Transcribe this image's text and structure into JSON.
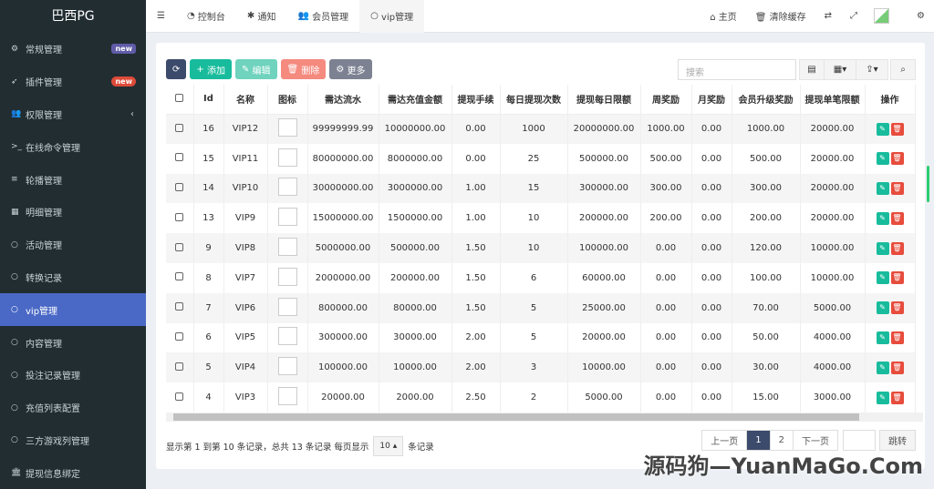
{
  "app": {
    "title": "巴西PG"
  },
  "sidebar": {
    "items": [
      {
        "label": "常规管理",
        "icon": "cogs-icon",
        "badge": "new",
        "badge_color": "#605ca8"
      },
      {
        "label": "插件管理",
        "icon": "rocket-icon",
        "badge": "new",
        "badge_color": "#dd4b39"
      },
      {
        "label": "权限管理",
        "icon": "users-icon",
        "chevron": "‹"
      },
      {
        "label": "在线命令管理",
        "icon": "terminal-icon"
      },
      {
        "label": "轮播管理",
        "icon": "list-icon"
      },
      {
        "label": "明细管理",
        "icon": "calendar-icon"
      },
      {
        "label": "活动管理",
        "icon": "circle-icon"
      },
      {
        "label": "转换记录",
        "icon": "circle-icon"
      },
      {
        "label": "vip管理",
        "icon": "circle-icon",
        "active": true
      },
      {
        "label": "内容管理",
        "icon": "circle-icon"
      },
      {
        "label": "投注记录管理",
        "icon": "circle-icon"
      },
      {
        "label": "充值列表配置",
        "icon": "circle-icon"
      },
      {
        "label": "三方游戏列管理",
        "icon": "circle-icon"
      },
      {
        "label": "提现信息绑定",
        "icon": "bank-icon"
      }
    ]
  },
  "topbar": {
    "tabs": [
      {
        "label": "控制台",
        "icon": "dashboard-icon"
      },
      {
        "label": "通知",
        "icon": "asterisk-icon"
      },
      {
        "label": "会员管理",
        "icon": "users-icon"
      },
      {
        "label": "vip管理",
        "icon": "circle-icon",
        "active": true
      }
    ],
    "home": "主页",
    "clear_cache": "清除缓存"
  },
  "toolbar": {
    "add": "添加",
    "edit": "编辑",
    "delete": "删除",
    "more": "更多",
    "search_placeholder": "搜索"
  },
  "table": {
    "headers": [
      "Id",
      "名称",
      "图标",
      "需达流水",
      "需达充值金额",
      "提现手续",
      "每日提现次数",
      "提现每日限额",
      "周奖励",
      "月奖励",
      "会员升级奖励",
      "提现单笔限额",
      "操作"
    ],
    "rows": [
      [
        "16",
        "VIP12",
        "",
        "99999999.99",
        "10000000.00",
        "0.00",
        "1000",
        "20000000.00",
        "1000.00",
        "0.00",
        "1000.00",
        "20000.00"
      ],
      [
        "15",
        "VIP11",
        "",
        "80000000.00",
        "8000000.00",
        "0.00",
        "25",
        "500000.00",
        "500.00",
        "0.00",
        "500.00",
        "20000.00"
      ],
      [
        "14",
        "VIP10",
        "",
        "30000000.00",
        "3000000.00",
        "1.00",
        "15",
        "300000.00",
        "300.00",
        "0.00",
        "300.00",
        "20000.00"
      ],
      [
        "13",
        "VIP9",
        "",
        "15000000.00",
        "1500000.00",
        "1.00",
        "10",
        "200000.00",
        "200.00",
        "0.00",
        "200.00",
        "20000.00"
      ],
      [
        "9",
        "VIP8",
        "",
        "5000000.00",
        "500000.00",
        "1.50",
        "10",
        "100000.00",
        "0.00",
        "0.00",
        "120.00",
        "10000.00"
      ],
      [
        "8",
        "VIP7",
        "",
        "2000000.00",
        "200000.00",
        "1.50",
        "6",
        "60000.00",
        "0.00",
        "0.00",
        "100.00",
        "10000.00"
      ],
      [
        "7",
        "VIP6",
        "",
        "800000.00",
        "80000.00",
        "1.50",
        "5",
        "25000.00",
        "0.00",
        "0.00",
        "70.00",
        "5000.00"
      ],
      [
        "6",
        "VIP5",
        "",
        "300000.00",
        "30000.00",
        "2.00",
        "5",
        "20000.00",
        "0.00",
        "0.00",
        "50.00",
        "4000.00"
      ],
      [
        "5",
        "VIP4",
        "",
        "100000.00",
        "10000.00",
        "2.00",
        "3",
        "10000.00",
        "0.00",
        "0.00",
        "30.00",
        "4000.00"
      ],
      [
        "4",
        "VIP3",
        "",
        "20000.00",
        "2000.00",
        "2.50",
        "2",
        "5000.00",
        "0.00",
        "0.00",
        "15.00",
        "3000.00"
      ]
    ]
  },
  "footer": {
    "summary": "显示第 1 到第 10 条记录，总共 13 条记录 每页显示",
    "page_size": "10",
    "suffix": "条记录",
    "prev": "上一页",
    "pages": [
      "1",
      "2"
    ],
    "current_page": "1",
    "next": "下一页",
    "jump": "跳转"
  },
  "watermark": "源码狗—YuanMaGo.Com"
}
